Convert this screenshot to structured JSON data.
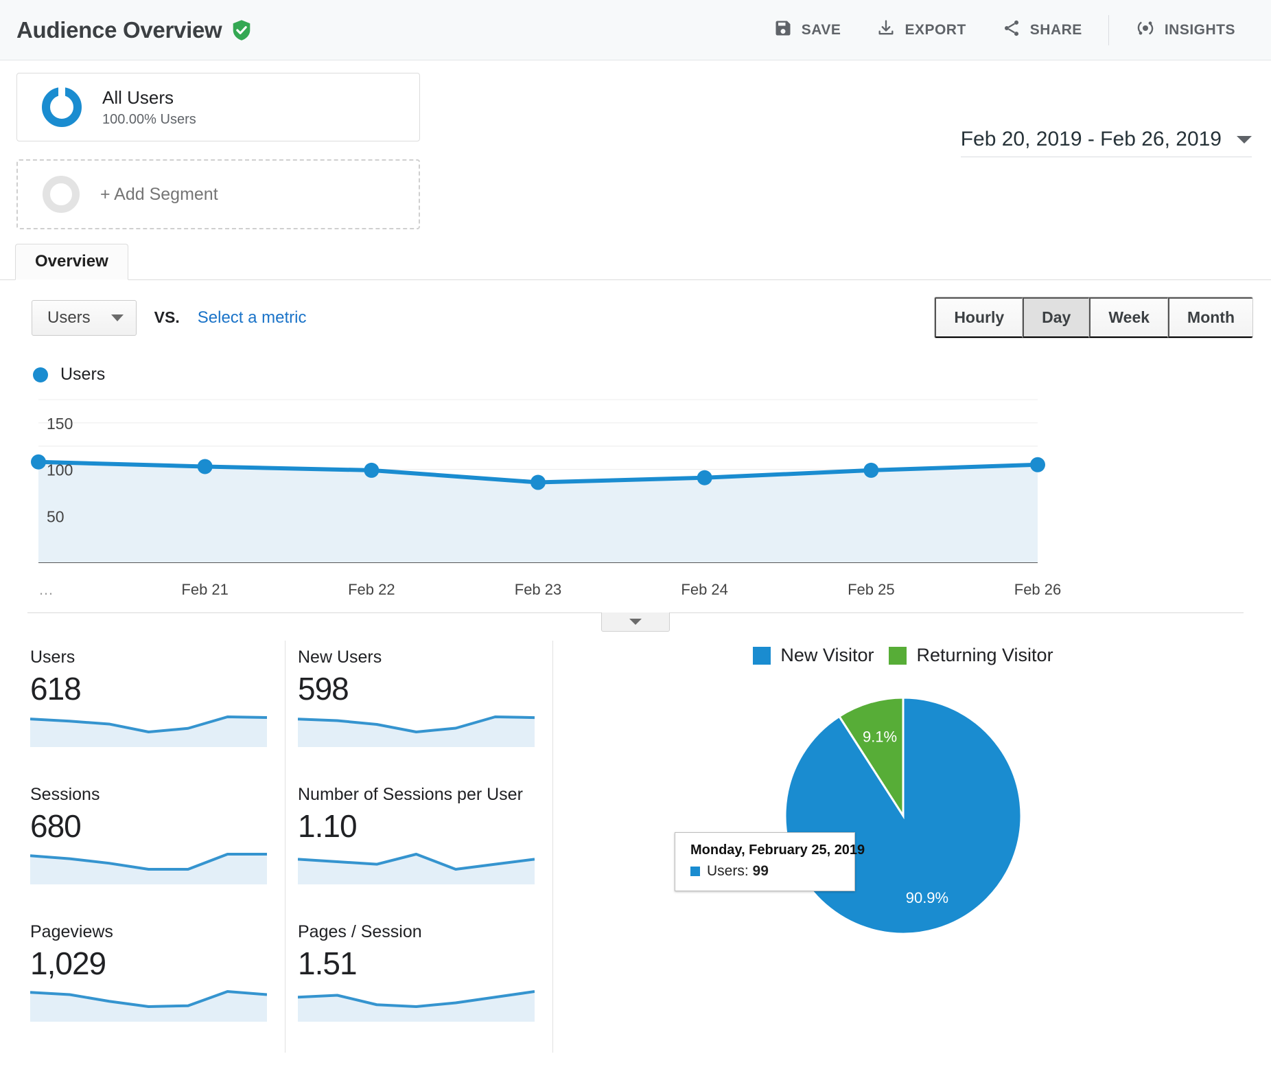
{
  "header": {
    "title": "Audience Overview",
    "verified_icon": "shield-check-icon",
    "actions": [
      {
        "label": "SAVE",
        "icon": "save-icon"
      },
      {
        "label": "EXPORT",
        "icon": "download-icon"
      },
      {
        "label": "SHARE",
        "icon": "share-icon"
      },
      {
        "label": "INSIGHTS",
        "icon": "insights-icon"
      }
    ]
  },
  "segments": {
    "all_users": {
      "name": "All Users",
      "sub": "100.00% Users"
    },
    "add_segment_label": "+ Add Segment"
  },
  "date_range": {
    "value": "Feb 20, 2019 - Feb 26, 2019"
  },
  "tabs": [
    {
      "label": "Overview",
      "active": true
    }
  ],
  "metric_bar": {
    "selected_metric": "Users",
    "vs_label": "VS.",
    "select_metric_link": "Select a metric",
    "granularity": [
      {
        "label": "Hourly",
        "active": false
      },
      {
        "label": "Day",
        "active": true
      },
      {
        "label": "Week",
        "active": false
      },
      {
        "label": "Month",
        "active": false
      }
    ]
  },
  "line_chart_legend": {
    "label": "Users"
  },
  "tooltip": {
    "title": "Monday, February 25, 2019",
    "series_label": "Users:",
    "value": "99"
  },
  "colors": {
    "accent_blue": "#1a8cd0",
    "green": "#57ad37",
    "link_blue": "#1a73c8",
    "shield_green": "#34a853"
  },
  "metric_cards": [
    {
      "label": "Users",
      "value": "618",
      "spark": [
        104,
        101,
        97,
        86,
        91,
        107,
        106
      ]
    },
    {
      "label": "New Users",
      "value": "598",
      "spark": [
        101,
        99,
        94,
        84,
        89,
        104,
        103
      ]
    },
    {
      "label": "Sessions",
      "value": "680",
      "spark": [
        114,
        110,
        104,
        96,
        96,
        116,
        116
      ]
    },
    {
      "label": "Number of Sessions per User",
      "value": "1.10",
      "spark": [
        1.1,
        1.09,
        1.08,
        1.12,
        1.06,
        1.08,
        1.1
      ]
    },
    {
      "label": "Pageviews",
      "value": "1,029",
      "spark": [
        170,
        165,
        150,
        138,
        140,
        172,
        165
      ]
    },
    {
      "label": "Pages / Session",
      "value": "1.51",
      "spark": [
        1.49,
        1.5,
        1.45,
        1.44,
        1.46,
        1.49,
        1.52
      ]
    }
  ],
  "pie_legend": [
    {
      "label": "New Visitor",
      "color": "#1a8cd0"
    },
    {
      "label": "Returning Visitor",
      "color": "#57ad37"
    }
  ],
  "axis": {
    "y_ticks": [
      "150",
      "100",
      "50"
    ],
    "x_ticks": [
      "…",
      "Feb 21",
      "Feb 22",
      "Feb 23",
      "Feb 24",
      "Feb 25",
      "Feb 26"
    ]
  },
  "chart_data": [
    {
      "type": "line",
      "title": "Users",
      "xlabel": "",
      "ylabel": "Users",
      "x": [
        "Feb 20",
        "Feb 21",
        "Feb 22",
        "Feb 23",
        "Feb 24",
        "Feb 25",
        "Feb 26"
      ],
      "series": [
        {
          "name": "Users",
          "values": [
            108,
            103,
            99,
            86,
            91,
            99,
            105
          ],
          "color": "#1a8cd0"
        }
      ],
      "ylim": [
        0,
        175
      ],
      "y_ticks": [
        50,
        100,
        150
      ],
      "grid": true,
      "legend": "top-left",
      "area_fill": "#e7f1f8",
      "annotation": {
        "point": "Feb 25",
        "label": "Monday, February 25, 2019",
        "value": 99
      }
    },
    {
      "type": "pie",
      "title": "",
      "labels": [
        "New Visitor",
        "Returning Visitor"
      ],
      "values": [
        90.9,
        9.1
      ],
      "value_labels": [
        "90.9%",
        "9.1%"
      ],
      "colors": [
        "#1a8cd0",
        "#57ad37"
      ],
      "legend": "top"
    }
  ]
}
